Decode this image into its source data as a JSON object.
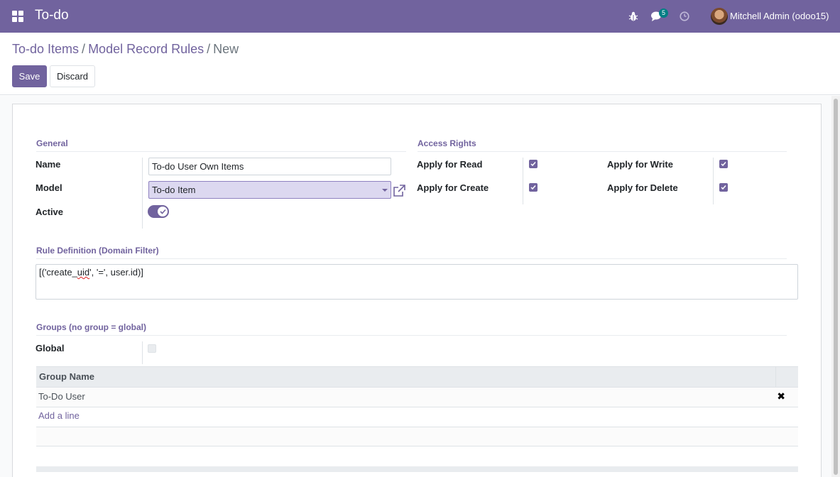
{
  "navbar": {
    "app_title": "To-do",
    "chat_badge": "5",
    "user_name": "Mitchell Admin (odoo15)"
  },
  "breadcrumb": {
    "items": [
      "To-do Items",
      "Model Record Rules"
    ],
    "current": "New"
  },
  "buttons": {
    "save": "Save",
    "discard": "Discard"
  },
  "general": {
    "title": "General",
    "name_label": "Name",
    "name_value": "To-do User Own Items",
    "model_label": "Model",
    "model_value": "To-do Item",
    "active_label": "Active",
    "active": true
  },
  "access_rights": {
    "title": "Access Rights",
    "read_label": "Apply for Read",
    "write_label": "Apply for Write",
    "create_label": "Apply for Create",
    "delete_label": "Apply for Delete",
    "read": true,
    "write": true,
    "create": true,
    "delete": true
  },
  "rule_definition": {
    "title": "Rule Definition (Domain Filter)",
    "domain_prefix": "[('create_",
    "domain_flagged": "uid",
    "domain_suffix": "', '=', user.id)]"
  },
  "groups": {
    "title": "Groups (no group = global)",
    "global_label": "Global",
    "global": false,
    "column_header": "Group Name",
    "rows": [
      "To-Do User"
    ],
    "add_line": "Add a line"
  },
  "colors": {
    "brand": "#71639e",
    "badge": "#017e84"
  }
}
